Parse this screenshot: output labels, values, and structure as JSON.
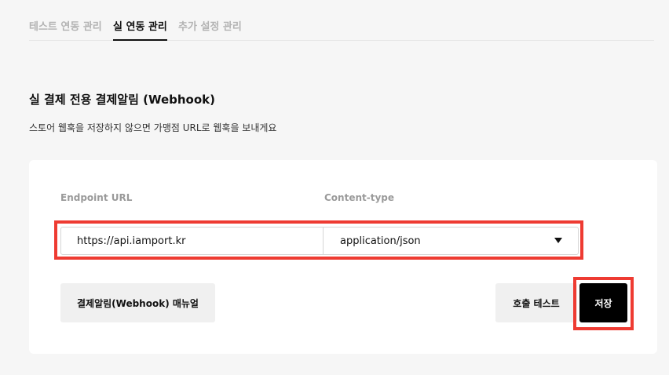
{
  "tabs": [
    {
      "label": "테스트 연동 관리",
      "active": false
    },
    {
      "label": "실 연동 관리",
      "active": true
    },
    {
      "label": "추가 설정 관리",
      "active": false
    }
  ],
  "section": {
    "title": "실 결제 전용 결제알림 (Webhook)",
    "description": "스토어 웹훅을 저장하지 않으면 가맹점 URL로 웹훅을 보내게요"
  },
  "form": {
    "endpoint_label": "Endpoint URL",
    "endpoint_value": "https://api.iamport.kr",
    "content_type_label": "Content-type",
    "content_type_value": "application/json"
  },
  "buttons": {
    "manual": "결제알림(Webhook) 매뉴얼",
    "test": "호출 테스트",
    "save": "저장"
  },
  "colors": {
    "highlight": "#ee3b32",
    "save_button": "#000000"
  },
  "icons": {
    "dropdown": "caret-down-icon"
  }
}
